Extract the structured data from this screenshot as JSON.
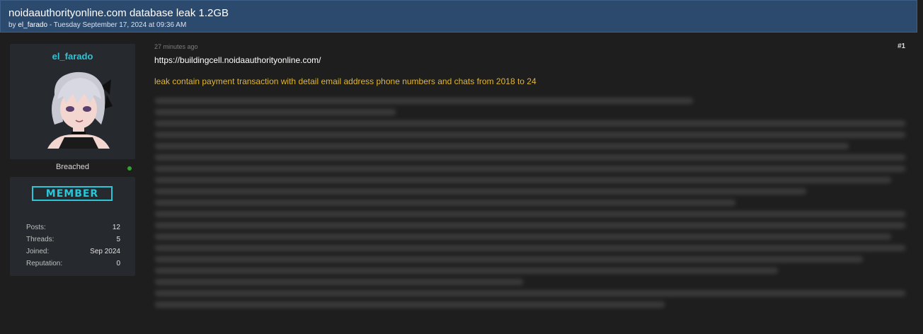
{
  "thread": {
    "title": "noidaauthorityonline.com database leak 1.2GB",
    "meta_prefix": "by ",
    "author": "el_farado",
    "meta_suffix": " - Tuesday September 17, 2024 at 09:36 AM"
  },
  "user": {
    "username": "el_farado",
    "avatar_icon": "anime-avatar-icon",
    "usergroup": "Breached",
    "online_color": "#2fa52f",
    "badge": "MEMBER",
    "stats": [
      {
        "label": "Posts:",
        "value": "12"
      },
      {
        "label": "Threads:",
        "value": "5"
      },
      {
        "label": "Joined:",
        "value": "Sep 2024"
      },
      {
        "label": "Reputation:",
        "value": "0"
      }
    ]
  },
  "post": {
    "time": "27 minutes ago",
    "number": "#1",
    "link": "https://buildingcell.noidaauthorityonline.com/",
    "highlight": "leak contain payment transaction with detail email address phone numbers and chats from 2018 to 24"
  },
  "colors": {
    "header_bg": "#2c4a6e",
    "accent": "#2bc5d8",
    "highlight_text": "#e2b52f",
    "page_bg": "#1e1e1e"
  }
}
